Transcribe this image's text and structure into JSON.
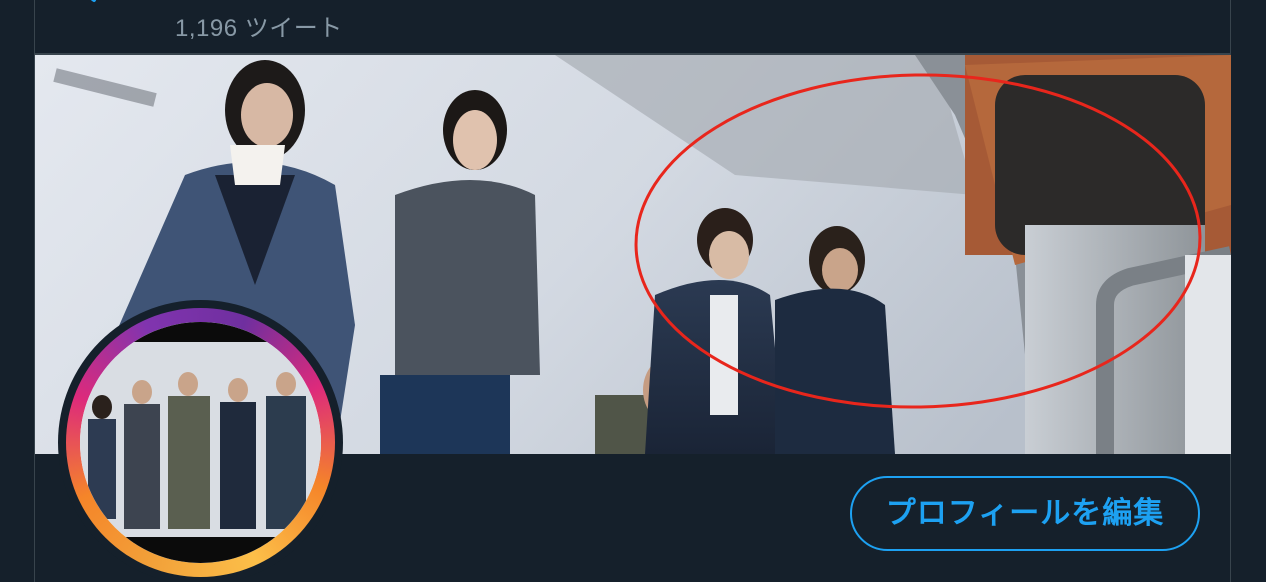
{
  "header": {
    "back_icon": "arrow-left-icon",
    "tweet_count": "1,196 ツイート"
  },
  "profile": {
    "edit_button_label": "プロフィールを編集"
  },
  "colors": {
    "background": "#15202b",
    "accent": "#1da1f2",
    "muted_text": "#8899a6",
    "annotation": "#e8261c"
  }
}
